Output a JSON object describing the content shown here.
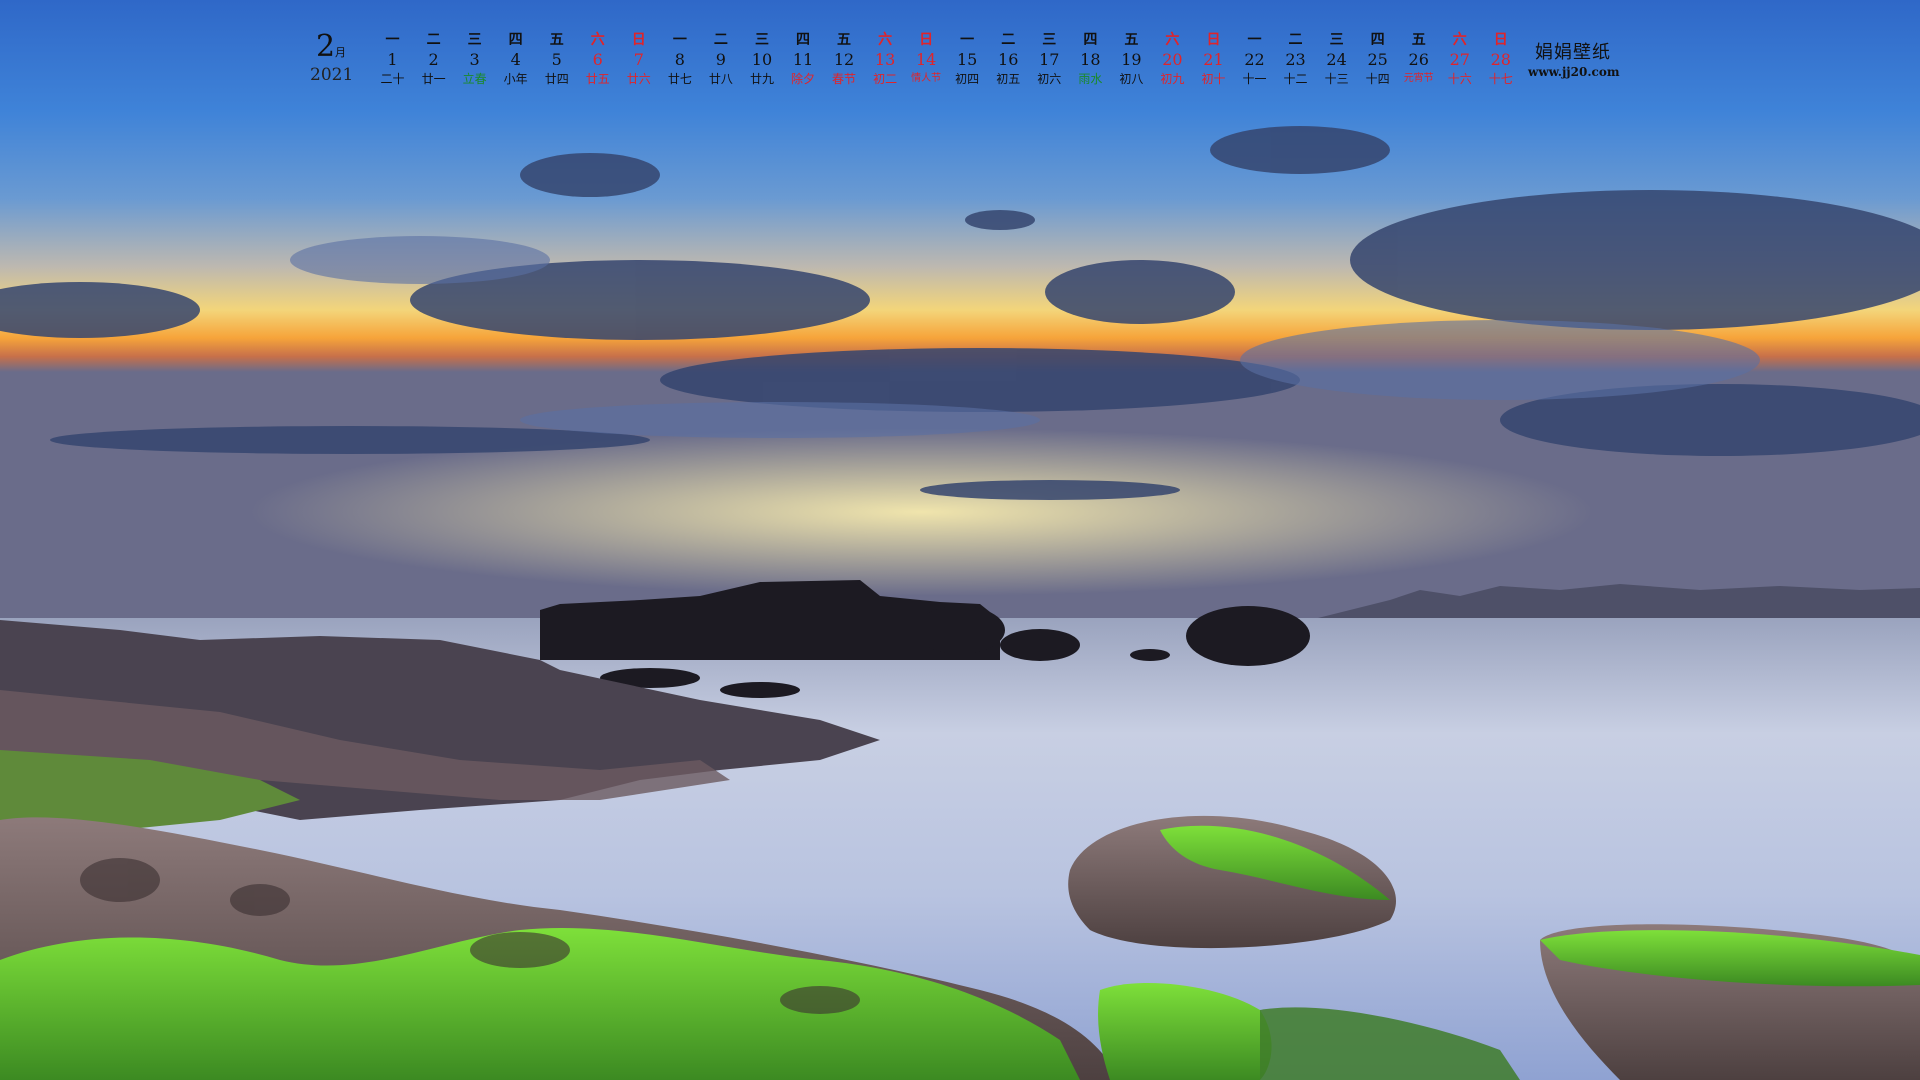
{
  "calendar": {
    "month": "2",
    "month_unit": "月",
    "year": "2021",
    "colors": {
      "normal": "#111111",
      "weekend": "#e0242a",
      "solar_term": "#1a8a2a",
      "festival": "#e0242a"
    },
    "days": [
      {
        "wk": "一",
        "d": "1",
        "l": "二十",
        "lt": "normal",
        "w": false
      },
      {
        "wk": "二",
        "d": "2",
        "l": "廿一",
        "lt": "normal",
        "w": false
      },
      {
        "wk": "三",
        "d": "3",
        "l": "立春",
        "lt": "solar_term",
        "w": false
      },
      {
        "wk": "四",
        "d": "4",
        "l": "小年",
        "lt": "normal",
        "w": false
      },
      {
        "wk": "五",
        "d": "5",
        "l": "廿四",
        "lt": "normal",
        "w": false
      },
      {
        "wk": "六",
        "d": "6",
        "l": "廿五",
        "lt": "weekend",
        "w": true
      },
      {
        "wk": "日",
        "d": "7",
        "l": "廿六",
        "lt": "weekend",
        "w": true
      },
      {
        "wk": "一",
        "d": "8",
        "l": "廿七",
        "lt": "normal",
        "w": false
      },
      {
        "wk": "二",
        "d": "9",
        "l": "廿八",
        "lt": "normal",
        "w": false
      },
      {
        "wk": "三",
        "d": "10",
        "l": "廿九",
        "lt": "normal",
        "w": false
      },
      {
        "wk": "四",
        "d": "11",
        "l": "除夕",
        "lt": "festival",
        "w": false
      },
      {
        "wk": "五",
        "d": "12",
        "l": "春节",
        "lt": "festival",
        "w": false
      },
      {
        "wk": "六",
        "d": "13",
        "l": "初二",
        "lt": "weekend",
        "w": true
      },
      {
        "wk": "日",
        "d": "14",
        "l": "情人节",
        "lt": "weekend",
        "w": true
      },
      {
        "wk": "一",
        "d": "15",
        "l": "初四",
        "lt": "normal",
        "w": false
      },
      {
        "wk": "二",
        "d": "16",
        "l": "初五",
        "lt": "normal",
        "w": false
      },
      {
        "wk": "三",
        "d": "17",
        "l": "初六",
        "lt": "normal",
        "w": false
      },
      {
        "wk": "四",
        "d": "18",
        "l": "雨水",
        "lt": "solar_term",
        "w": false
      },
      {
        "wk": "五",
        "d": "19",
        "l": "初八",
        "lt": "normal",
        "w": false
      },
      {
        "wk": "六",
        "d": "20",
        "l": "初九",
        "lt": "weekend",
        "w": true
      },
      {
        "wk": "日",
        "d": "21",
        "l": "初十",
        "lt": "weekend",
        "w": true
      },
      {
        "wk": "一",
        "d": "22",
        "l": "十一",
        "lt": "normal",
        "w": false
      },
      {
        "wk": "二",
        "d": "23",
        "l": "十二",
        "lt": "normal",
        "w": false
      },
      {
        "wk": "三",
        "d": "24",
        "l": "十三",
        "lt": "normal",
        "w": false
      },
      {
        "wk": "四",
        "d": "25",
        "l": "十四",
        "lt": "normal",
        "w": false
      },
      {
        "wk": "五",
        "d": "26",
        "l": "元宵节",
        "lt": "festival",
        "w": false
      },
      {
        "wk": "六",
        "d": "27",
        "l": "十六",
        "lt": "weekend",
        "w": true
      },
      {
        "wk": "日",
        "d": "28",
        "l": "十七",
        "lt": "weekend",
        "w": true
      }
    ]
  },
  "brand": {
    "name": "娟娟壁纸",
    "url": "www.jj20.com"
  }
}
